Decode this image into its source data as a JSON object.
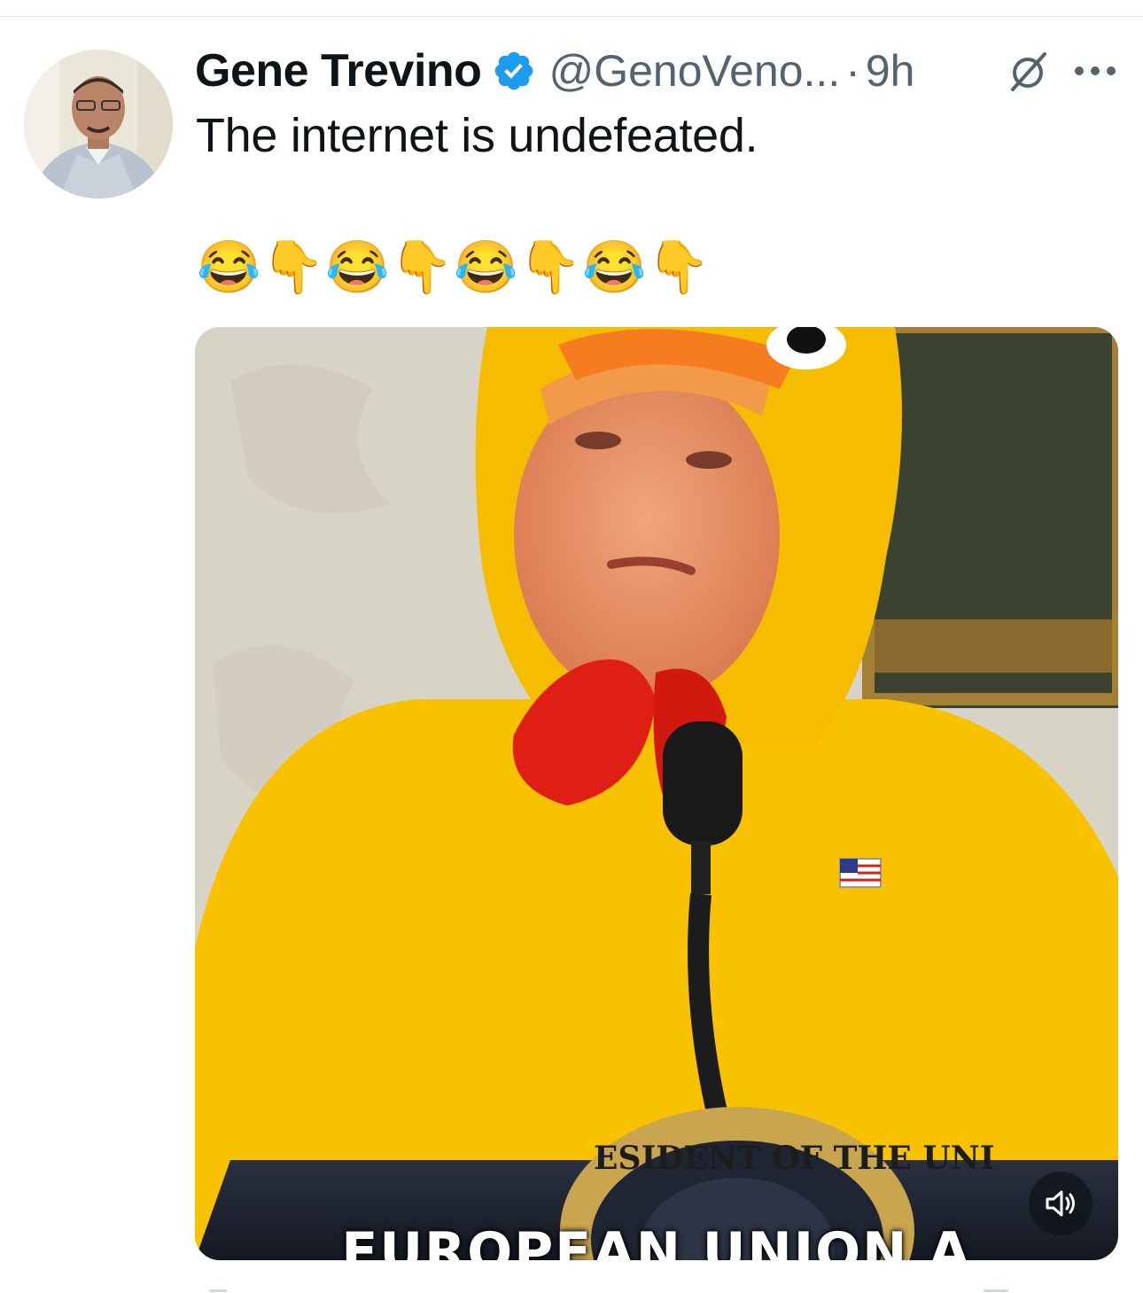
{
  "tweet": {
    "display_name": "Gene Trevino",
    "handle": "@GenoVeno...",
    "separator": "·",
    "time": "9h",
    "text": "The internet is undefeated.",
    "emojis": [
      "😂",
      "👇",
      "😂",
      "👇",
      "😂",
      "👇",
      "😂",
      "👇"
    ]
  },
  "media": {
    "caption": "EUROPEAN UNION A",
    "seal_text": "ESIDENT OF THE UNI"
  },
  "colors": {
    "verified": "#1d9bf0",
    "secondary_text": "#536471"
  },
  "icons": {
    "verified": "verified-badge-icon",
    "grok": "grok-icon",
    "more": "more-options-icon",
    "volume": "volume-icon"
  }
}
